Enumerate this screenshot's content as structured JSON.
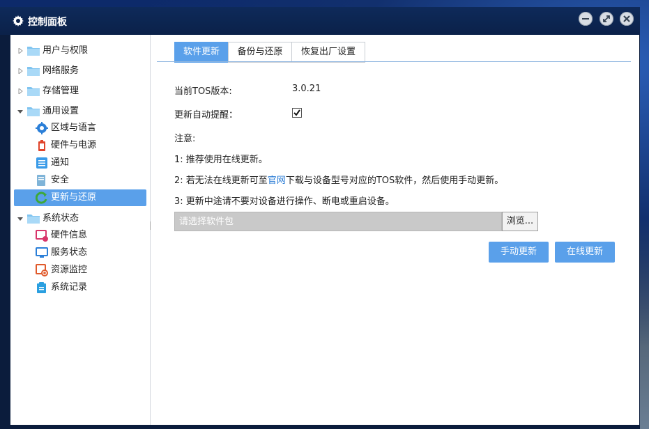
{
  "window": {
    "title": "控制面板"
  },
  "sidebar": {
    "groups": [
      {
        "label": "用户与权限",
        "expanded": false
      },
      {
        "label": "网络服务",
        "expanded": false
      },
      {
        "label": "存储管理",
        "expanded": false
      },
      {
        "label": "通用设置",
        "expanded": true,
        "items": [
          "区域与语言",
          "硬件与电源",
          "通知",
          "安全",
          "更新与还原"
        ]
      },
      {
        "label": "系统状态",
        "expanded": true,
        "items": [
          "硬件信息",
          "服务状态",
          "资源监控",
          "系统记录"
        ]
      }
    ],
    "selected": "更新与还原"
  },
  "tabs": [
    "软件更新",
    "备份与还原",
    "恢复出厂设置"
  ],
  "active_tab": "软件更新",
  "main": {
    "version_label": "当前TOS版本:",
    "version_value": "3.0.21",
    "auto_remind_label": "更新自动提醒：",
    "auto_remind_checked": true,
    "note_title": "注意:",
    "note1": "1: 推荐使用在线更新。",
    "note2_pre": "2: 若无法在线更新可至",
    "note2_link": "官网",
    "note2_post": "下载与设备型号对应的TOS软件，然后使用手动更新。",
    "note3": "3: 更新中途请不要对设备进行操作、断电或重启设备。",
    "file_placeholder": "请选择软件包",
    "browse_label": "浏览...",
    "manual_update_label": "手动更新",
    "online_update_label": "在线更新"
  },
  "colors": {
    "accent": "#5aa0ea",
    "titlebar": "#0b2149",
    "link": "#2a7cd6"
  }
}
